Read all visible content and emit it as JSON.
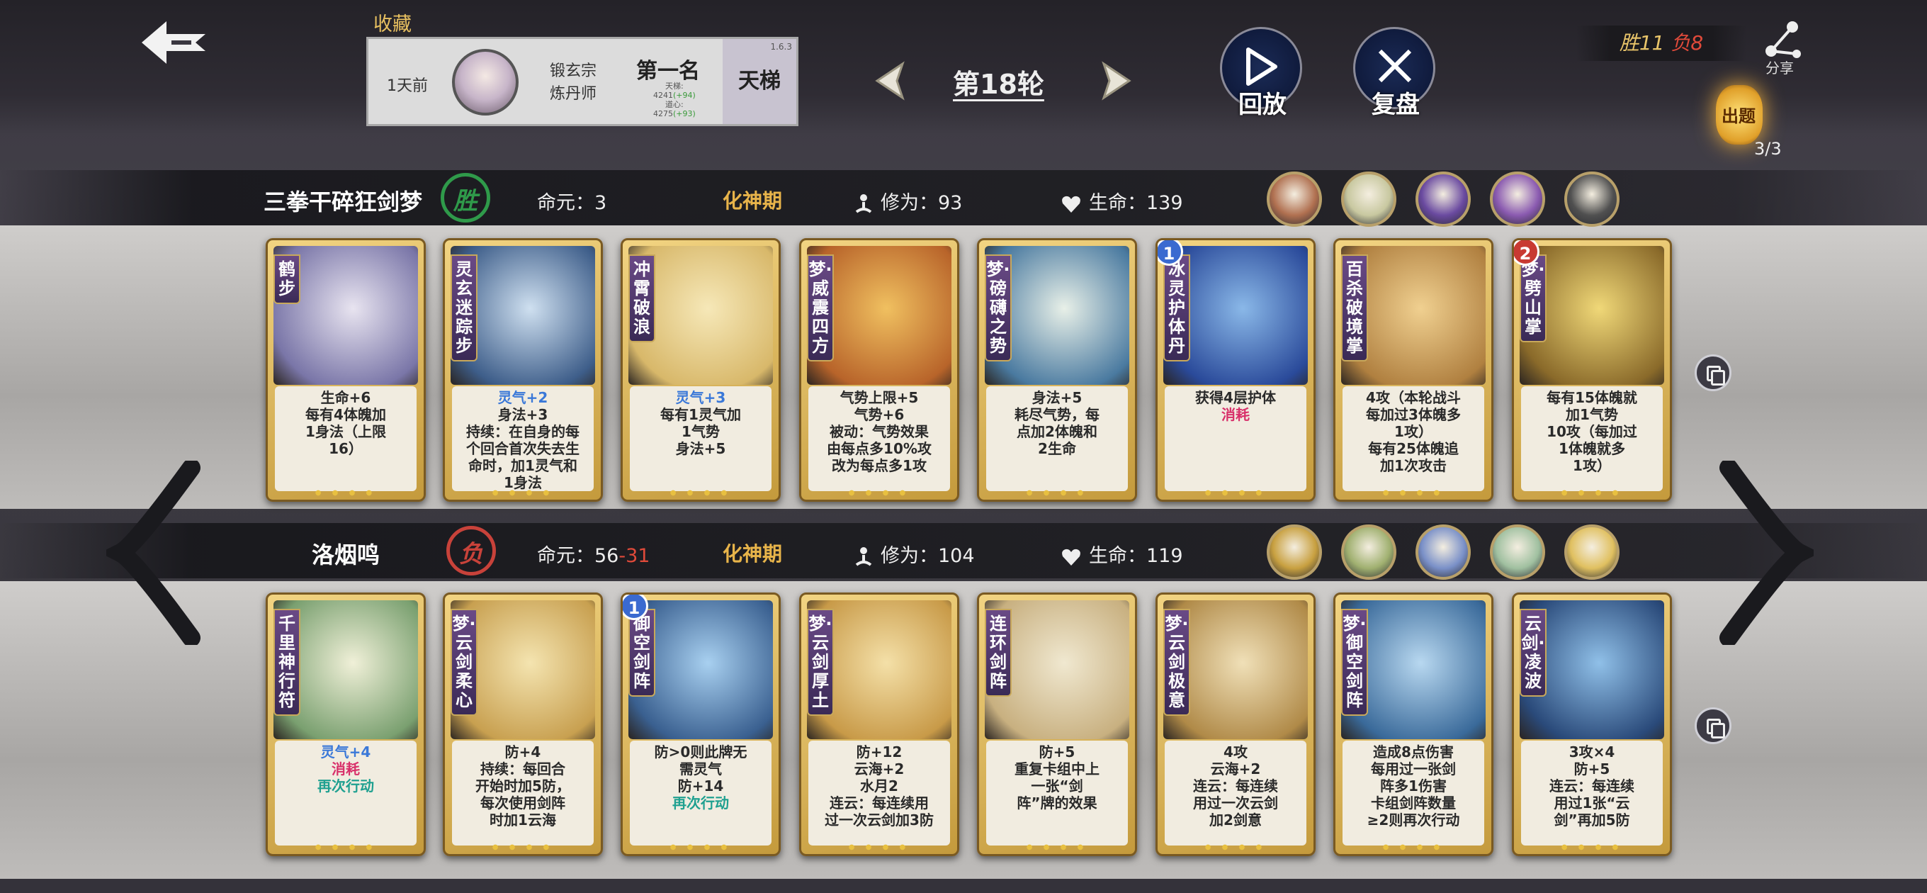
{
  "header": {
    "favorite_label": "收藏",
    "replay": {
      "days_ago": "1天前",
      "sect": "锻玄宗",
      "profession": "炼丹师",
      "rank": "第一名",
      "sub_line1": "天梯:",
      "sub_line2a": "4241",
      "sub_line2b": "(+94)",
      "sub_line3": "道心:",
      "sub_line4a": "4275",
      "sub_line4b": "(+93)",
      "mode": "天梯",
      "version": "1.6.3"
    },
    "round_label": "第18轮",
    "replay_button": "回放",
    "review_button": "复盘",
    "score": {
      "win_label": "胜11",
      "loss_label": "负8"
    },
    "share_label": "分享",
    "quiz": {
      "label": "出题",
      "count": "3/3"
    }
  },
  "players": [
    {
      "name": "三拳干碎狂剑梦",
      "result": "胜",
      "result_color": "#2f9a4a",
      "life_core_label": "命元：",
      "life_core_value": "3",
      "life_core_delta": "",
      "realm": "化神期",
      "cultivation_label": "修为：",
      "cultivation_value": "93",
      "hp_label": "生命：",
      "hp_value": "139",
      "avatars": [
        "avatar-elder",
        "avatar-monk",
        "avatar-purple-mage",
        "avatar-white-hair",
        "avatar-yin-yang"
      ],
      "cards": [
        {
          "name": "鹤步",
          "level": "",
          "desc": [
            "生命+6",
            "每有4体魄加",
            "1身法（上限",
            "16）"
          ]
        },
        {
          "name": "灵玄迷踪步",
          "level": "",
          "desc": [
            "灵气+2",
            "身法+3",
            "持续：在自身的每",
            "个回合首次失去生",
            "命时，加1灵气和",
            "1身法"
          ]
        },
        {
          "name": "冲霄破浪",
          "level": "",
          "desc": [
            "灵气+3",
            "每有1灵气加",
            "1气势",
            "身法+5"
          ]
        },
        {
          "name": "梦・威震四方",
          "level": "",
          "desc": [
            "气势上限+5",
            "气势+6",
            "被动：气势效果",
            "由每点多10%攻",
            "改为每点多1攻"
          ]
        },
        {
          "name": "梦・磅礴之势",
          "level": "",
          "desc": [
            "身法+5",
            "耗尽气势，每",
            "点加2体魄和",
            "2生命"
          ]
        },
        {
          "name": "冰灵护体丹",
          "level": "1",
          "desc": [
            "获得4层护体",
            "消耗"
          ]
        },
        {
          "name": "百杀破境掌",
          "level": "",
          "desc": [
            "4攻（本轮战斗",
            "每加过3体魄多",
            "1攻）",
            "每有25体魄追",
            "加1次攻击"
          ]
        },
        {
          "name": "梦・劈山掌",
          "level": "2",
          "desc": [
            "每有15体魄就",
            "加1气势",
            "10攻（每加过",
            "1体魄就多",
            "1攻）"
          ]
        }
      ]
    },
    {
      "name": "洛烟鸣",
      "result": "负",
      "result_color": "#c8423a",
      "life_core_label": "命元：",
      "life_core_value": "56",
      "life_core_delta": "-31",
      "realm": "化神期",
      "cultivation_label": "修为：",
      "cultivation_value": "104",
      "hp_label": "生命：",
      "hp_value": "119",
      "avatars": [
        "avatar-spiral",
        "avatar-twins",
        "avatar-swordsman",
        "avatar-twins-2",
        "avatar-gold-mark"
      ],
      "cards": [
        {
          "name": "千里神行符",
          "level": "",
          "desc": [
            "灵气+4",
            "消耗",
            "再次行动"
          ]
        },
        {
          "name": "梦・云剑柔心",
          "level": "",
          "desc": [
            "防+4",
            "持续：每回合",
            "开始时加5防，",
            "每次使用剑阵",
            "时加1云海"
          ]
        },
        {
          "name": "御空剑阵",
          "level": "1",
          "desc": [
            "防>0则此牌无",
            "需灵气",
            "防+14",
            "再次行动"
          ]
        },
        {
          "name": "梦・云剑厚土",
          "level": "",
          "desc": [
            "防+12",
            "云海+2",
            "水月2",
            "连云：每连续用",
            "过一次云剑加3防"
          ]
        },
        {
          "name": "连环剑阵",
          "level": "",
          "desc": [
            "防+5",
            "重复卡组中上",
            "一张“剑",
            "阵”牌的效果"
          ]
        },
        {
          "name": "梦・云剑极意",
          "level": "",
          "desc": [
            "4攻",
            "云海+2",
            "连云：每连续",
            "用过一次云剑",
            "加2剑意"
          ]
        },
        {
          "name": "梦・御空剑阵",
          "level": "",
          "desc": [
            "造成8点伤害",
            "每用过一张剑",
            "阵多1伤害",
            "卡组剑阵数量",
            "≥2则再次行动"
          ]
        },
        {
          "name": "云剑・凌波",
          "level": "",
          "desc": [
            "3攻×4",
            "防+5",
            "连云：每连续",
            "用过1张“云",
            "剑”再加5防"
          ]
        }
      ]
    }
  ],
  "colors": {
    "gold": "#e8b44a",
    "win": "#2f9a4a",
    "loss": "#c8423a",
    "buff_blue": "#3a78d8",
    "consume_pink": "#d8306a",
    "action_teal": "#1fa090"
  }
}
